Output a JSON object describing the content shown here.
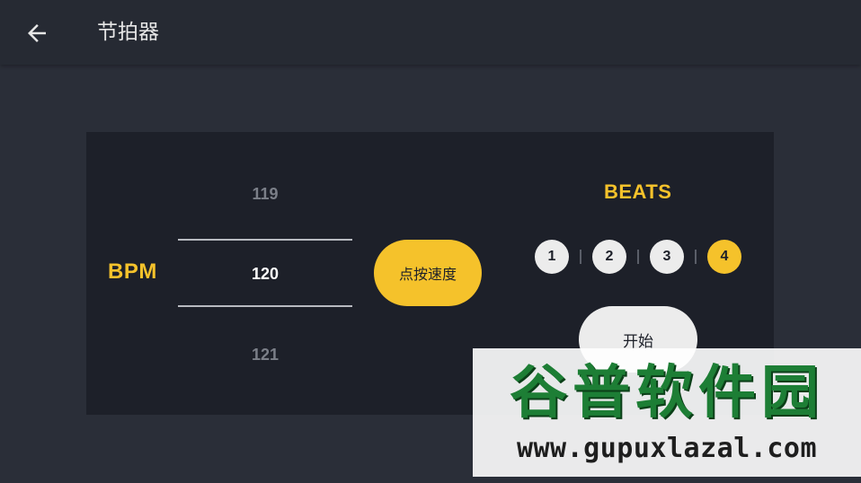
{
  "header": {
    "back_icon": "arrow-left-icon",
    "title": "节拍器"
  },
  "bpm": {
    "label": "BPM",
    "prev": "119",
    "current": "120",
    "next": "121"
  },
  "tap_button": {
    "label": "点按速度"
  },
  "beats": {
    "label": "BEATS",
    "items": [
      "1",
      "2",
      "3",
      "4"
    ],
    "active_index": 3
  },
  "start_button": {
    "label": "开始"
  },
  "watermark": {
    "title": "谷普软件园",
    "url": "www.gupuxlazal.com"
  },
  "colors": {
    "background": "#2a2e38",
    "topbar": "#262a33",
    "panel": "#1d2029",
    "accent": "#f5c22b",
    "light_button": "#ececec"
  }
}
